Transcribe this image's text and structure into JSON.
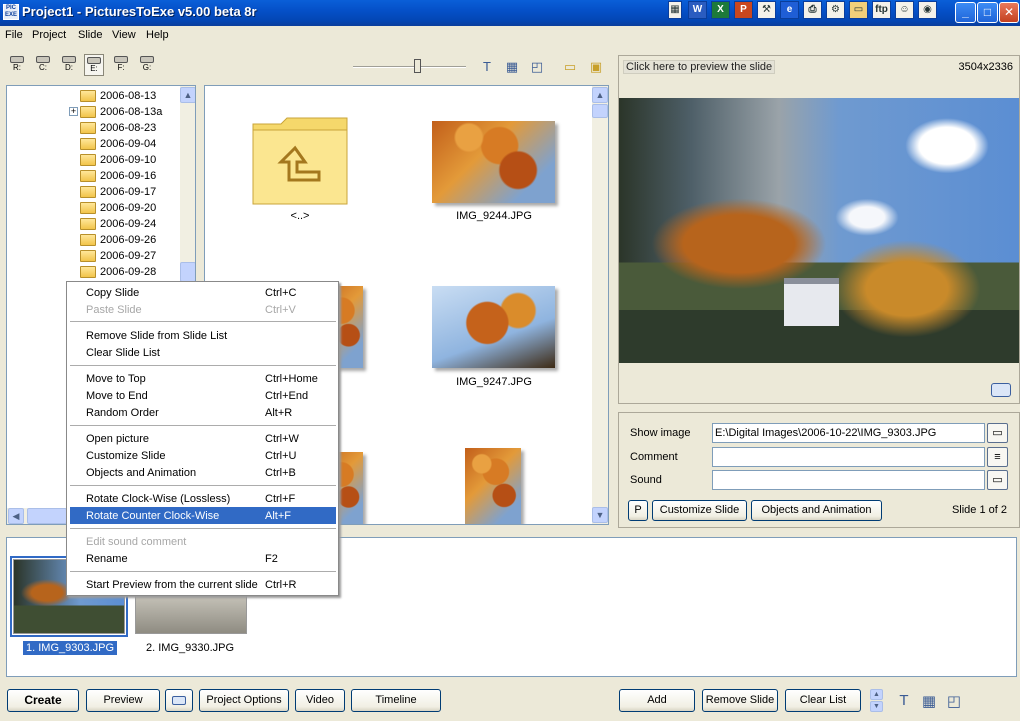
{
  "window": {
    "title": "Project1 - PicturesToExe v5.00 beta 8r",
    "app_icon_text": "PIC EXE"
  },
  "menu": [
    "File",
    "Project",
    "Slide",
    "View",
    "Help"
  ],
  "drives": [
    "R:",
    "C:",
    "D:",
    "E:",
    "F:",
    "G:"
  ],
  "tree": {
    "folders": [
      "2006-08-13",
      "2006-08-13a",
      "2006-08-23",
      "2006-09-04",
      "2006-09-10",
      "2006-09-16",
      "2006-09-17",
      "2006-09-20",
      "2006-09-24",
      "2006-09-26",
      "2006-09-27",
      "2006-09-28"
    ],
    "expand_symbol": "+"
  },
  "browser": {
    "files": [
      "<..>",
      "IMG_9244.JPG",
      "IMG_9247.JPG"
    ]
  },
  "preview": {
    "hint": "Click here to preview the slide",
    "size": "3504x2336"
  },
  "slide_props": {
    "show_image_label": "Show image",
    "show_image_value": "E:\\Digital Images\\2006-10-22\\IMG_9303.JPG",
    "comment_label": "Comment",
    "comment_value": "",
    "sound_label": "Sound",
    "sound_value": "",
    "p_label": "P",
    "customize_label": "Customize Slide",
    "objects_label": "Objects and Animation",
    "counter": "Slide 1 of 2"
  },
  "context_menu": [
    {
      "label": "Copy Slide",
      "shortcut": "Ctrl+C",
      "disabled": false
    },
    {
      "label": "Paste Slide",
      "shortcut": "Ctrl+V",
      "disabled": true
    },
    {
      "label": "Remove Slide from Slide List",
      "shortcut": "",
      "disabled": false
    },
    {
      "label": "Clear Slide List",
      "shortcut": "",
      "disabled": false
    },
    {
      "label": "Move to Top",
      "shortcut": "Ctrl+Home",
      "disabled": false
    },
    {
      "label": "Move to End",
      "shortcut": "Ctrl+End",
      "disabled": false
    },
    {
      "label": "Random Order",
      "shortcut": "Alt+R",
      "disabled": false
    },
    {
      "label": "Open picture",
      "shortcut": "Ctrl+W",
      "disabled": false
    },
    {
      "label": "Customize Slide",
      "shortcut": "Ctrl+U",
      "disabled": false
    },
    {
      "label": "Objects and Animation",
      "shortcut": "Ctrl+B",
      "disabled": false
    },
    {
      "label": "Rotate Clock-Wise (Lossless)",
      "shortcut": "Ctrl+F",
      "disabled": false
    },
    {
      "label": "Rotate Counter Clock-Wise",
      "shortcut": "Alt+F",
      "disabled": false,
      "highlighted": true
    },
    {
      "label": "Edit sound comment",
      "shortcut": "",
      "disabled": true
    },
    {
      "label": "Rename",
      "shortcut": "F2",
      "disabled": false
    },
    {
      "label": "Start Preview from the current slide",
      "shortcut": "Ctrl+R",
      "disabled": false
    }
  ],
  "slides": [
    "1. IMG_9303.JPG",
    "2. IMG_9330.JPG"
  ],
  "bottom": {
    "create": "Create",
    "preview": "Preview",
    "project_options": "Project Options",
    "video": "Video",
    "timeline": "Timeline",
    "add": "Add",
    "remove": "Remove Slide",
    "clear": "Clear List"
  },
  "icons": {
    "text_tool": "T",
    "up": "▲",
    "down": "▼",
    "left": "◀",
    "right": "▶",
    "minimize": "_",
    "maximize": "□",
    "close": "✕",
    "folder_open": "📂"
  }
}
